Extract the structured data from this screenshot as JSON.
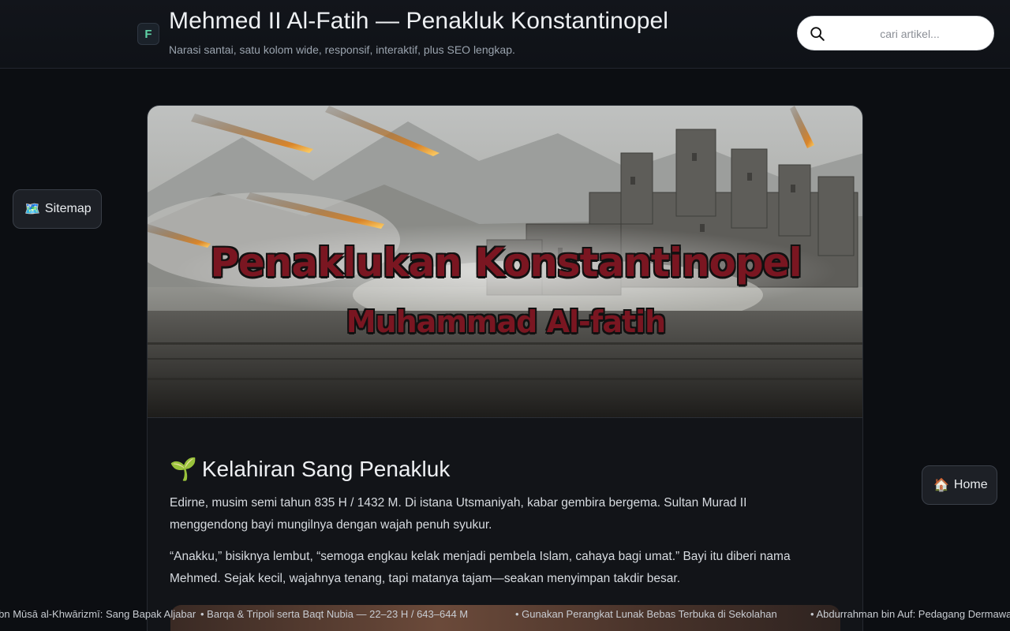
{
  "header": {
    "logo_letter": "F",
    "title": "Mehmed II Al-Fatih — Penakluk Konstantinopel",
    "tagline": "Narasi santai, satu kolom wide, responsif, interaktif, plus SEO lengkap."
  },
  "search": {
    "placeholder": "cari artikel..."
  },
  "hero": {
    "title": "Penaklukan Konstantinopel",
    "subtitle": "Muhammad Al-fatih"
  },
  "article": {
    "heading_emoji": "🌱",
    "heading": "Kelahiran Sang Penakluk",
    "paragraphs": [
      "Edirne, musim semi tahun 835 H / 1432 M. Di istana Utsmaniyah, kabar gembira bergema. Sultan Murad II menggendong bayi mungilnya dengan wajah penuh syukur.",
      "“Anakku,” bisiknya lembut, “semoga engkau kelak menjadi pembela Islam, cahaya bagi umat.” Bayi itu diberi nama Mehmed. Sejak kecil, wajahnya tenang, tapi matanya tajam—seakan menyimpan takdir besar."
    ]
  },
  "buttons": {
    "sitemap_icon": "🗺️",
    "sitemap_label": "Sitemap",
    "home_icon": "🏠",
    "home_label": "Home"
  },
  "ticker": [
    "Muḥammad ibn Mūsā al-Khwārizmī: Sang Bapak Aljabar",
    "• Barqa & Tripoli serta Baqt Nubia — 22–23 H / 643–644 M",
    "• Gunakan Perangkat Lunak Bebas Terbuka di Sekolahan",
    "• Abdurrahman bin Auf: Pedagang Dermawan"
  ]
}
